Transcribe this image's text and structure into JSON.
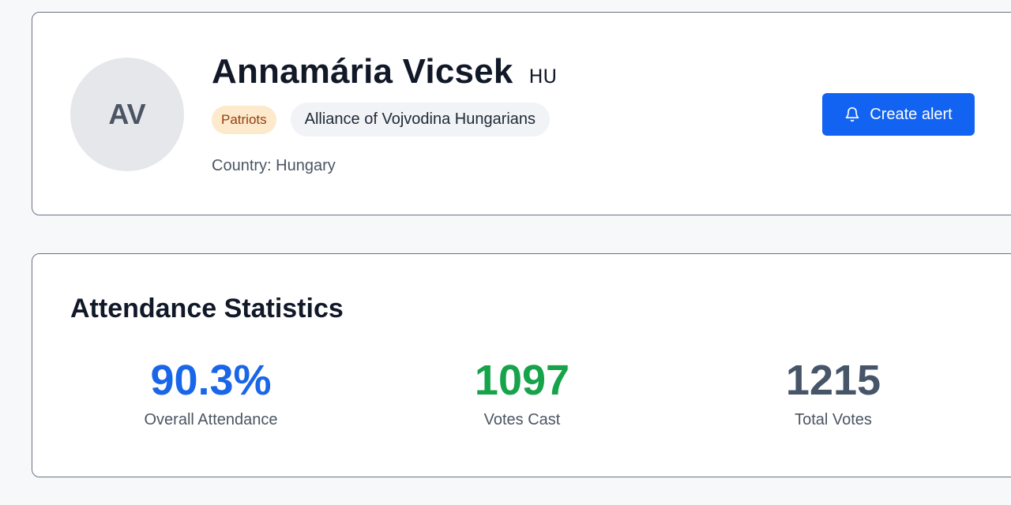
{
  "profile": {
    "initials": "AV",
    "name": "Annamária Vicsek",
    "country_code": "HU",
    "group_badge": "Patriots",
    "party_badge": "Alliance of Vojvodina Hungarians",
    "country_line": "Country: Hungary",
    "create_alert_label": "Create alert",
    "create_alert_icon": "bell-icon"
  },
  "stats": {
    "title": "Attendance Statistics",
    "items": [
      {
        "value": "90.3%",
        "label": "Overall Attendance",
        "color": "#1a66e8"
      },
      {
        "value": "1097",
        "label": "Votes Cast",
        "color": "#16a34a"
      },
      {
        "value": "1215",
        "label": "Total Votes",
        "color": "#475569"
      }
    ]
  },
  "colors": {
    "accent": "#1263f1",
    "group_badge_bg": "#fde9cc",
    "group_badge_text": "#92400e"
  }
}
